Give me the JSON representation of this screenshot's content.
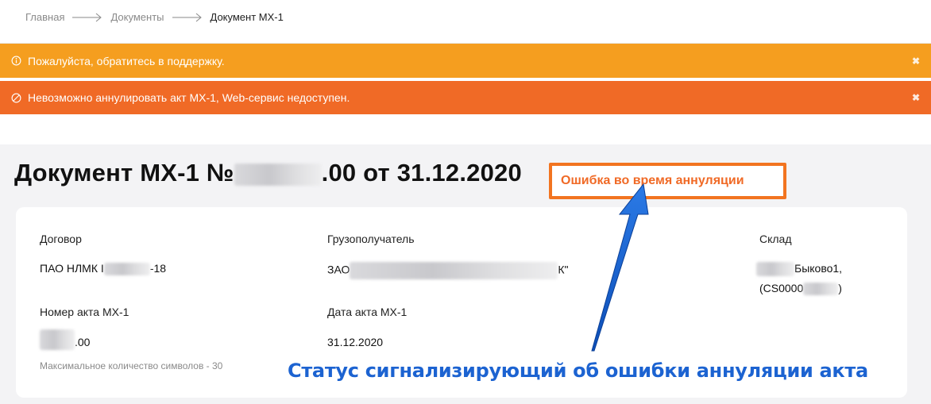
{
  "breadcrumb": {
    "items": [
      "Главная",
      "Документы",
      "Документ МХ-1"
    ]
  },
  "alerts": {
    "warning_text": "Пожалуйста, обратитесь в поддержку.",
    "error_text": "Невозможно аннулировать акт МХ-1, Web-сервис недоступен.",
    "close_symbol": "✖"
  },
  "document": {
    "title_prefix": "Документ МХ-1 №",
    "title_suffix": ".00 от 31.12.2020",
    "status": "Ошибка во время аннуляции"
  },
  "fields": {
    "contract_label": "Договор",
    "contract_value_prefix": "ПАО НЛМК I",
    "contract_value_suffix": "-18",
    "consignee_label": "Грузополучатель",
    "consignee_value_prefix": "ЗАО",
    "consignee_value_suffix": "К\"",
    "warehouse_label": "Склад",
    "warehouse_line1": "Быково1,",
    "warehouse_line2_prefix": "(CS0000",
    "warehouse_line2_suffix": ")",
    "act_number_label": "Номер акта МХ-1",
    "act_number_value_suffix": ".00",
    "act_number_hint": "Максимальное количество символов - 30",
    "act_date_label": "Дата акта МХ-1",
    "act_date_value": "31.12.2020"
  },
  "annotation": {
    "text": "Статус сигнализирующий об ошибки аннуляции акта"
  },
  "colors": {
    "warning": "#f59e1f",
    "error": "#f06a26",
    "annotation": "#1c63d1"
  }
}
